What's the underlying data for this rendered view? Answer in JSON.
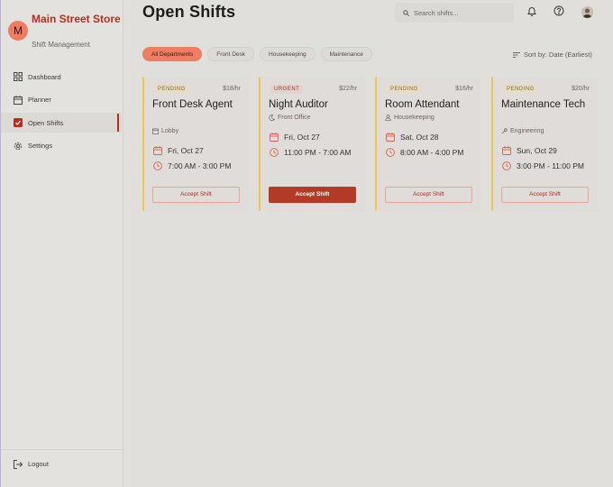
{
  "brand": {
    "initial": "M",
    "name": "Main Street Store",
    "subtitle": "Shift Management"
  },
  "nav": {
    "items": [
      {
        "label": "Dashboard",
        "icon": "grid-icon",
        "active": false
      },
      {
        "label": "Planner",
        "icon": "calendar-icon",
        "active": false
      },
      {
        "label": "Open Shifts",
        "icon": "check-square-icon",
        "active": true
      },
      {
        "label": "Settings",
        "icon": "gear-icon",
        "active": false
      }
    ],
    "logout": "Logout"
  },
  "header": {
    "title": "Open Shifts",
    "search_placeholder": "Search shifts...",
    "icons": [
      "bell-icon",
      "help-icon",
      "user-avatar"
    ]
  },
  "filters": {
    "chips": [
      "All Departments",
      "Front Desk",
      "Housekeeping",
      "Maintenance"
    ],
    "active": "All Departments",
    "sort_label": "Sort by: Date (Earliest)"
  },
  "colors": {
    "accent": "#b0301c",
    "chip_active": "#ef7d62",
    "pending_border": "#f0c54d",
    "primary_button": "#b23a26"
  },
  "shifts": [
    {
      "status": "PENDING",
      "pay": "$18/hr",
      "role": "Front Desk Agent",
      "location": "Lobby",
      "location_icon": "building-icon",
      "date": "Fri, Oct 27",
      "time": "7:00 AM - 3:00 PM",
      "action": "Accept Shift",
      "primary": false
    },
    {
      "status": "URGENT",
      "pay": "$22/hr",
      "role": "Night Auditor",
      "location": "Front Office",
      "location_icon": "moon-icon",
      "date": "Fri, Oct 27",
      "time": "11:00 PM - 7:00 AM",
      "action": "Accept Shift",
      "primary": true
    },
    {
      "status": "PENDING",
      "pay": "$16/hr",
      "role": "Room Attendant",
      "location": "Housekeeping",
      "location_icon": "person-icon",
      "date": "Sat, Oct 28",
      "time": "8:00 AM - 4:00 PM",
      "action": "Accept Shift",
      "primary": false
    },
    {
      "status": "PENDING",
      "pay": "$20/hr",
      "role": "Maintenance Tech",
      "location": "Engineering",
      "location_icon": "wrench-icon",
      "date": "Sun, Oct 29",
      "time": "3:00 PM - 11:00 PM",
      "action": "Accept Shift",
      "primary": false
    }
  ]
}
